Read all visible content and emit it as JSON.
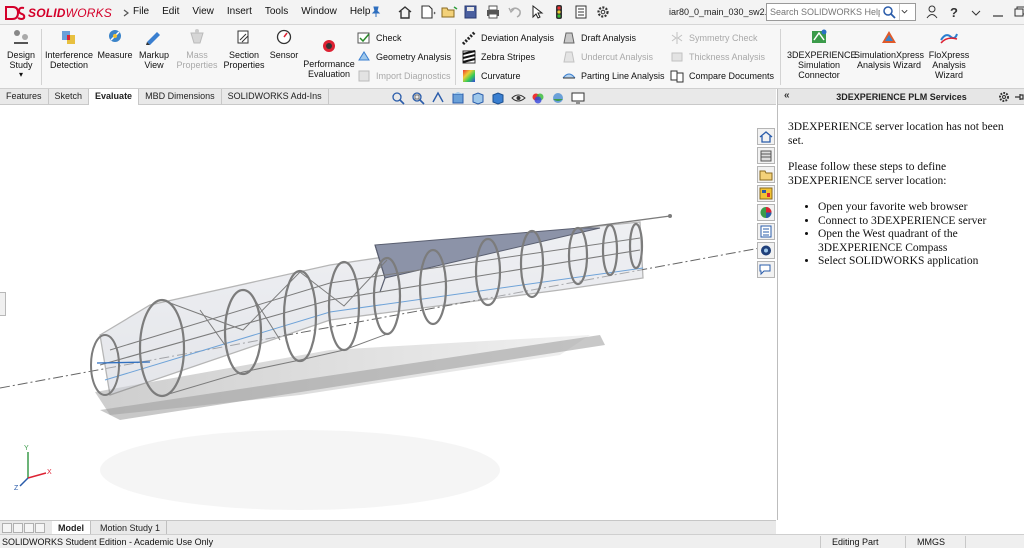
{
  "titlebar": {
    "app_name_bold": "SOLID",
    "app_name_rest": "WORKS",
    "menu": [
      "File",
      "Edit",
      "View",
      "Insert",
      "Tools",
      "Window",
      "Help"
    ],
    "document_title": "iar80_0_main_030_sw2...",
    "search_placeholder": "Search SOLIDWORKS Help",
    "quick_access_icons": [
      "home-icon",
      "new-document-icon",
      "open-icon",
      "save-icon",
      "print-icon",
      "undo-icon",
      "select-icon",
      "rebuild-icon",
      "file-properties-icon",
      "options-icon"
    ],
    "right_icons": [
      "user-icon",
      "help-icon",
      "minimize-icon",
      "restore-icon"
    ]
  },
  "ribbon": {
    "large_buttons": [
      {
        "name": "design-study",
        "line1": "Design",
        "line2": "Study",
        "line3": "",
        "enabled": true
      },
      {
        "name": "interference-detection",
        "line1": "Interference",
        "line2": "Detection",
        "line3": "",
        "enabled": true
      },
      {
        "name": "measure",
        "line1": "Measure",
        "line2": "",
        "line3": "",
        "enabled": true
      },
      {
        "name": "markup-view",
        "line1": "Markup",
        "line2": "View",
        "line3": "",
        "enabled": true
      },
      {
        "name": "mass-properties",
        "line1": "Mass",
        "line2": "Properties",
        "line3": "",
        "enabled": false
      },
      {
        "name": "section-properties",
        "line1": "Section",
        "line2": "Properties",
        "line3": "",
        "enabled": true
      },
      {
        "name": "sensor",
        "line1": "Sensor",
        "line2": "",
        "line3": "",
        "enabled": true
      },
      {
        "name": "performance-evaluation",
        "line1": "Performance",
        "line2": "Evaluation",
        "line3": "",
        "enabled": true
      }
    ],
    "check_group": [
      {
        "name": "check",
        "label": "Check",
        "enabled": true
      },
      {
        "name": "geometry-analysis",
        "label": "Geometry Analysis",
        "enabled": true
      },
      {
        "name": "import-diagnostics",
        "label": "Import Diagnostics",
        "enabled": false
      }
    ],
    "analysis_group_1": [
      {
        "name": "deviation-analysis",
        "label": "Deviation Analysis",
        "enabled": true
      },
      {
        "name": "zebra-stripes",
        "label": "Zebra Stripes",
        "enabled": true
      },
      {
        "name": "curvature",
        "label": "Curvature",
        "enabled": true
      }
    ],
    "analysis_group_2": [
      {
        "name": "draft-analysis",
        "label": "Draft Analysis",
        "enabled": true
      },
      {
        "name": "undercut-analysis",
        "label": "Undercut Analysis",
        "enabled": false
      },
      {
        "name": "parting-line-analysis",
        "label": "Parting Line Analysis",
        "enabled": true
      }
    ],
    "analysis_group_3": [
      {
        "name": "symmetry-check",
        "label": "Symmetry Check",
        "enabled": false
      },
      {
        "name": "thickness-analysis",
        "label": "Thickness Analysis",
        "enabled": false
      },
      {
        "name": "compare-documents",
        "label": "Compare Documents",
        "enabled": true
      }
    ],
    "sim_buttons": [
      {
        "name": "3dexperience-simulation-connector",
        "line1": "3DEXPERIENCE",
        "line2": "Simulation",
        "line3": "Connector"
      },
      {
        "name": "simulationxpress-analysis-wizard",
        "line1": "SimulationXpress",
        "line2": "Analysis Wizard",
        "line3": ""
      },
      {
        "name": "floxpress-analysis-wizard",
        "line1": "FloXpress",
        "line2": "Analysis",
        "line3": "Wizard"
      }
    ]
  },
  "tabs": [
    "Features",
    "Sketch",
    "Evaluate",
    "MBD Dimensions",
    "SOLIDWORKS Add-Ins"
  ],
  "active_tab": "Evaluate",
  "task_pane": {
    "title": "3DEXPERIENCE PLM Services",
    "back_label": "«",
    "message1": "3DEXPERIENCE server location has not been set.",
    "message2": "Please follow these steps to define 3DEXPERIENCE server location:",
    "steps": [
      "Open your favorite web browser",
      "Connect to 3DEXPERIENCE server",
      "Open the West quadrant of the 3DEXPERIENCE Compass",
      "Select SOLIDWORKS application"
    ]
  },
  "bottom_tabs": [
    "Model",
    "Motion Study 1"
  ],
  "active_bottom_tab": "Model",
  "status_bar": {
    "edition": "SOLIDWORKS Student Edition - Academic Use Only",
    "mode": "Editing Part",
    "units": "MMGS"
  },
  "colors": {
    "brand_red": "#d4002a",
    "model_gray": "#7c7c7c",
    "accent_blue": "#3a7fd0"
  }
}
